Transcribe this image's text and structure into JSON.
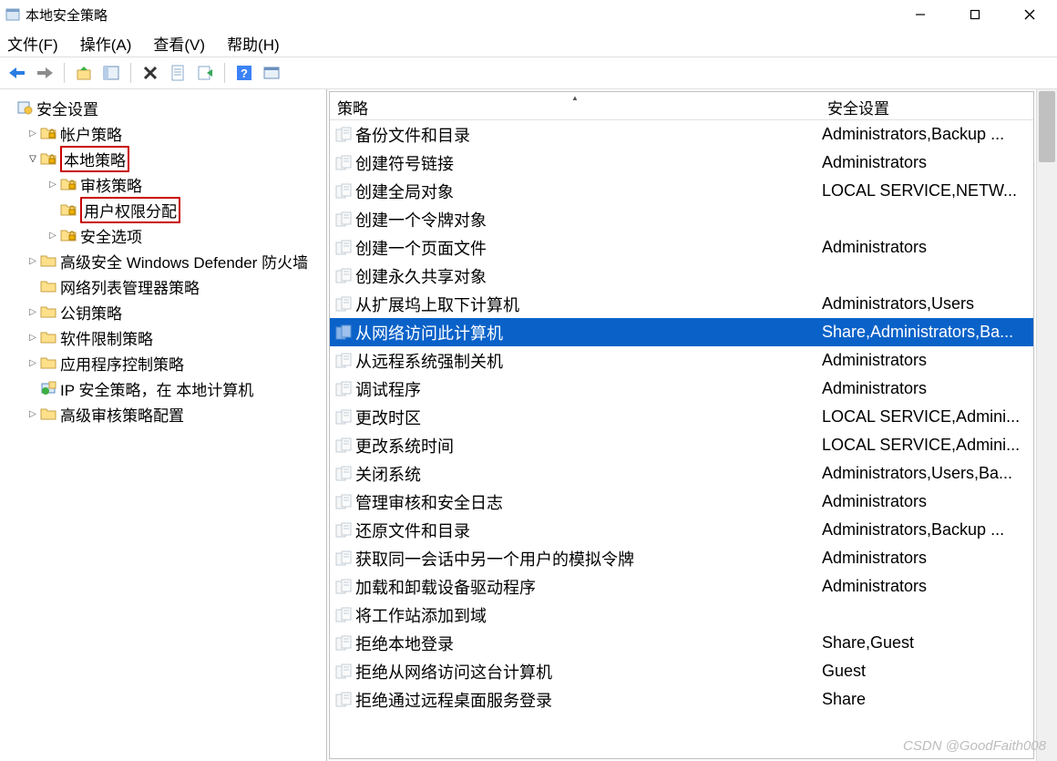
{
  "window_title": "本地安全策略",
  "menu": [
    "文件(F)",
    "操作(A)",
    "查看(V)",
    "帮助(H)"
  ],
  "tree_root": "安全设置",
  "tree": [
    {
      "label": "帐户策略",
      "twisty": ">",
      "indent": 1,
      "icon": "folder-lock"
    },
    {
      "label": "本地策略",
      "twisty": "v",
      "indent": 1,
      "icon": "folder-lock",
      "hl": true
    },
    {
      "label": "审核策略",
      "twisty": ">",
      "indent": 2,
      "icon": "folder-lock"
    },
    {
      "label": "用户权限分配",
      "twisty": "",
      "indent": 2,
      "icon": "folder-lock",
      "hl": true
    },
    {
      "label": "安全选项",
      "twisty": ">",
      "indent": 2,
      "icon": "folder-lock"
    },
    {
      "label": "高级安全 Windows Defender 防火墙",
      "twisty": ">",
      "indent": 1,
      "icon": "folder"
    },
    {
      "label": "网络列表管理器策略",
      "twisty": "",
      "indent": 1,
      "icon": "folder"
    },
    {
      "label": "公钥策略",
      "twisty": ">",
      "indent": 1,
      "icon": "folder"
    },
    {
      "label": "软件限制策略",
      "twisty": ">",
      "indent": 1,
      "icon": "folder"
    },
    {
      "label": "应用程序控制策略",
      "twisty": ">",
      "indent": 1,
      "icon": "folder"
    },
    {
      "label": "IP 安全策略，在 本地计算机",
      "twisty": "",
      "indent": 1,
      "icon": "ip"
    },
    {
      "label": "高级审核策略配置",
      "twisty": ">",
      "indent": 1,
      "icon": "folder"
    }
  ],
  "columns": {
    "policy": "策略",
    "setting": "安全设置"
  },
  "rows": [
    {
      "p": "备份文件和目录",
      "s": "Administrators,Backup ..."
    },
    {
      "p": "创建符号链接",
      "s": "Administrators"
    },
    {
      "p": "创建全局对象",
      "s": "LOCAL SERVICE,NETW..."
    },
    {
      "p": "创建一个令牌对象",
      "s": ""
    },
    {
      "p": "创建一个页面文件",
      "s": "Administrators"
    },
    {
      "p": "创建永久共享对象",
      "s": ""
    },
    {
      "p": "从扩展坞上取下计算机",
      "s": "Administrators,Users"
    },
    {
      "p": "从网络访问此计算机",
      "s": "Share,Administrators,Ba...",
      "sel": true
    },
    {
      "p": "从远程系统强制关机",
      "s": "Administrators"
    },
    {
      "p": "调试程序",
      "s": "Administrators"
    },
    {
      "p": "更改时区",
      "s": "LOCAL SERVICE,Admini..."
    },
    {
      "p": "更改系统时间",
      "s": "LOCAL SERVICE,Admini..."
    },
    {
      "p": "关闭系统",
      "s": "Administrators,Users,Ba..."
    },
    {
      "p": "管理审核和安全日志",
      "s": "Administrators"
    },
    {
      "p": "还原文件和目录",
      "s": "Administrators,Backup ..."
    },
    {
      "p": "获取同一会话中另一个用户的模拟令牌",
      "s": "Administrators"
    },
    {
      "p": "加载和卸载设备驱动程序",
      "s": "Administrators"
    },
    {
      "p": "将工作站添加到域",
      "s": ""
    },
    {
      "p": "拒绝本地登录",
      "s": "Share,Guest"
    },
    {
      "p": "拒绝从网络访问这台计算机",
      "s": "Guest"
    },
    {
      "p": "拒绝通过远程桌面服务登录",
      "s": "Share"
    }
  ],
  "watermark": "CSDN @GoodFaith008"
}
